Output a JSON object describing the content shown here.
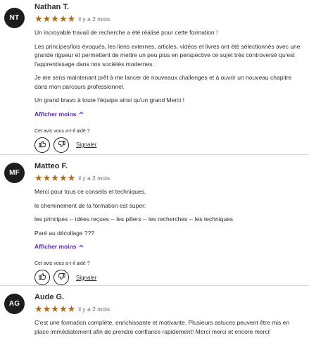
{
  "reviews": [
    {
      "initials": "NT",
      "name": "Nathan T.",
      "stars": "★★★★★",
      "time": "il y a 2 mois",
      "paragraphs": [
        "Un incroyable travail de recherche a été réalisé pour cette formation !",
        "Les principes/lois évoqués, les liens externes, articles, vidéos et livres ont été sélectionnés avec une grande rigueur et permettent de mettre un peu plus en perspective ce sujet très controversé qu'est l'apprentissage dans nos sociétés modernes.",
        "Je me sens maintenant prêt à me lancer de nouveaux challenges et à ouvrir un nouveau chapitre dans mon parcours professionnel.",
        "Un grand bravo à toute l'équipe ainsi qu'un grand Merci !"
      ],
      "show_less": "Afficher moins",
      "helpful_prompt": "Cet avis vous a-t-il aidé ?",
      "report": "Signaler"
    },
    {
      "initials": "MF",
      "name": "Matteo F.",
      "stars": "★★★★★",
      "time": "il y a 2 mois",
      "paragraphs": [
        "Merci pour tous ce conseils et techniques,",
        "le cheminement de la formation est super:",
        "les principes -- idées reçues -- les piliers -- les recherches -- les techniques",
        "Paré au décollage ???"
      ],
      "show_less": "Afficher moins",
      "helpful_prompt": "Cet avis vous a-t-il aidé ?",
      "report": "Signaler"
    },
    {
      "initials": "AG",
      "name": "Aude G.",
      "stars": "★★★★★",
      "time": "il y a 2 mois",
      "paragraphs": [
        "C'est une formation complète, enrichissante et motivante. Plusieurs astuces peuvent être mis en place immédiatement afin de prendre confiance rapidement! Merci merci et encore merci!"
      ]
    }
  ],
  "icons": {
    "thumb_up": "thumbs-up-icon",
    "thumb_down": "thumbs-down-icon",
    "show_less": "chevron-up-icon",
    "star": "star-icon"
  },
  "colors": {
    "star": "#b4690e",
    "link": "#5624d0",
    "avatar_bg": "#1c1d1f"
  }
}
